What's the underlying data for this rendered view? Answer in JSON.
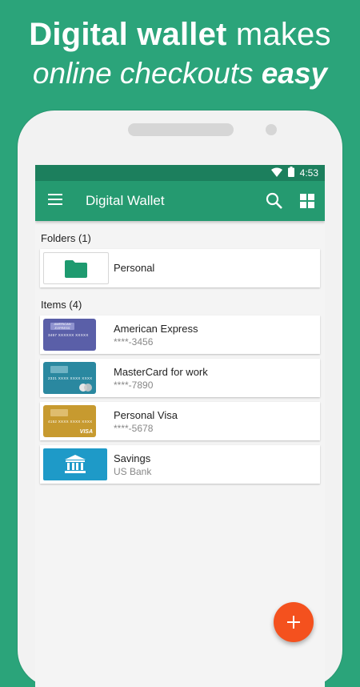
{
  "promo": {
    "line1_bold": "Digital wallet",
    "line1_rest": " makes",
    "line2_rest": "online checkouts ",
    "line2_bold": "easy"
  },
  "status": {
    "time": "4:53",
    "icons": [
      "wifi-icon",
      "battery-icon"
    ]
  },
  "appbar": {
    "title": "Digital Wallet",
    "icons": [
      "menu-icon",
      "search-icon",
      "grid-view-icon"
    ]
  },
  "folders": {
    "header": "Folders (1)",
    "items": [
      {
        "name": "Personal",
        "icon": "folder-icon"
      }
    ]
  },
  "items": {
    "header": "Items (4)",
    "list": [
      {
        "name": "American Express",
        "sub": "****-3456",
        "thumb": "amex-card",
        "number": "3457 XXXXXX XXXXX",
        "logo": "AMERICAN EXPRESS",
        "color": "#5a5fa8"
      },
      {
        "name": "MasterCard for work",
        "sub": "****-7890",
        "thumb": "mastercard-card",
        "number": "2321 XXXX XXXX XXXX",
        "color": "#2a88a0"
      },
      {
        "name": "Personal Visa",
        "sub": "****-5678",
        "thumb": "visa-card",
        "number": "4152 XXXX XXXX XXXX",
        "brand": "VISA",
        "color": "#c79a2f"
      },
      {
        "name": "Savings",
        "sub": "US Bank",
        "thumb": "bank-icon",
        "color": "#1e9ac8"
      }
    ]
  },
  "fab": {
    "icon": "add-icon",
    "color": "#f4511e"
  },
  "colors": {
    "background": "#2ba47a",
    "statusbar": "#1c7f5d",
    "appbar": "#259a70",
    "folder": "#1e9a6f"
  }
}
